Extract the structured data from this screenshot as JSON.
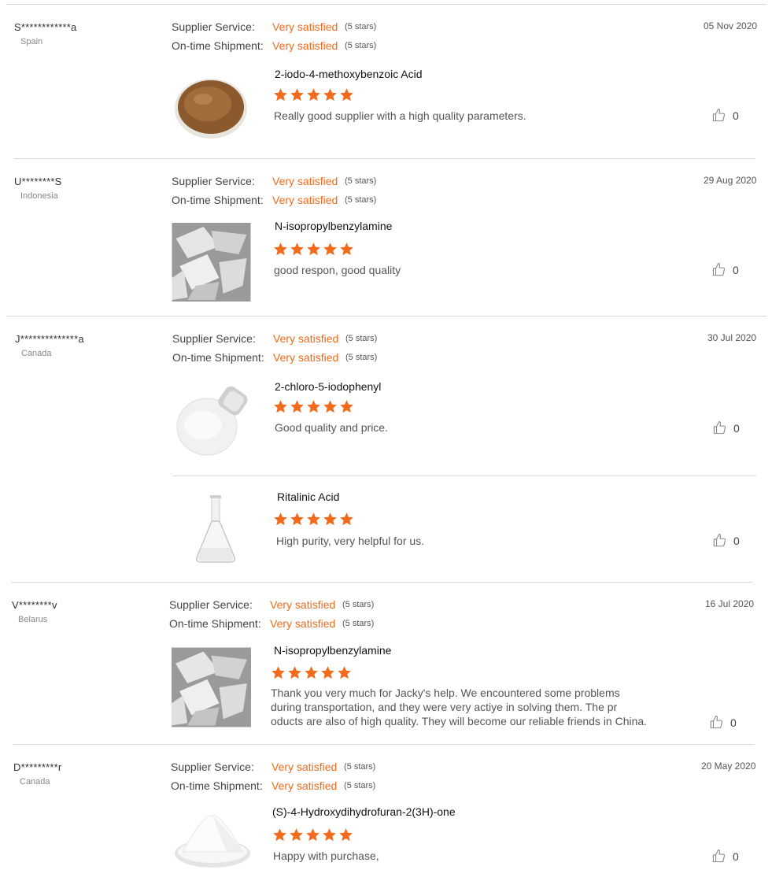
{
  "service_labels": {
    "supplier": "Supplier Service:",
    "shipment": "On-time Shipment:"
  },
  "colors": {
    "accent": "#f26a1b",
    "divider": "#d9d9d9"
  },
  "reviews": [
    {
      "user": "S************a",
      "country": "Spain",
      "date": "05 Nov 2020",
      "supplier_value": "Very satisfied",
      "supplier_stars": "(5 stars)",
      "shipment_value": "Very satisfied",
      "shipment_stars": "(5 stars)",
      "products": [
        {
          "name": "2-iodo-4-methoxybenzoic Acid",
          "rating": 5,
          "comment": "Really good supplier with a high quality parameters.",
          "likes": "0",
          "image": "brown-powder-dish"
        }
      ]
    },
    {
      "user": "U********S",
      "country": "Indonesia",
      "date": "29 Aug 2020",
      "supplier_value": "Very satisfied",
      "supplier_stars": "(5 stars)",
      "shipment_value": "Very satisfied",
      "shipment_stars": "(5 stars)",
      "products": [
        {
          "name": "N-isopropylbenzylamine",
          "rating": 5,
          "comment": "good respon, good quality",
          "likes": "0",
          "image": "crystals"
        }
      ]
    },
    {
      "user": "J**************a",
      "country": "Canada",
      "date": "30 Jul 2020",
      "supplier_value": "Very satisfied",
      "supplier_stars": "(5 stars)",
      "shipment_value": "Very satisfied",
      "shipment_stars": "(5 stars)",
      "products": [
        {
          "name": "2-chloro-5-iodophenyl",
          "rating": 5,
          "comment": "Good quality and price.",
          "likes": "0",
          "image": "white-powder-jar"
        },
        {
          "name": "Ritalinic Acid",
          "rating": 5,
          "comment": "High purity, very helpful for us.",
          "likes": "0",
          "image": "flask"
        }
      ]
    },
    {
      "user": "V********v",
      "country": "Belarus",
      "date": "16 Jul 2020",
      "supplier_value": "Very satisfied",
      "supplier_stars": "(5 stars)",
      "shipment_value": "Very satisfied",
      "shipment_stars": "(5 stars)",
      "products": [
        {
          "name": "N-isopropylbenzylamine",
          "rating": 5,
          "comment_lines": [
            "Thank you very much for Jacky's help. We encountered some problems",
            "during transportation, and they were very actiye in solving them. The pr",
            "oducts are also of high quality. They will become our reliable friends in China."
          ],
          "likes": "0",
          "image": "crystals"
        }
      ]
    },
    {
      "user": "D*********r",
      "country": "Canada",
      "date": "20 May 2020",
      "supplier_value": "Very satisfied",
      "supplier_stars": "(5 stars)",
      "shipment_value": "Very satisfied",
      "shipment_stars": "(5 stars)",
      "products": [
        {
          "name": "(S)-4-Hydroxydihydrofuran-2(3H)-one",
          "rating": 5,
          "comment": "Happy with purchase,",
          "likes": "0",
          "image": "white-powder-pile"
        }
      ]
    }
  ]
}
